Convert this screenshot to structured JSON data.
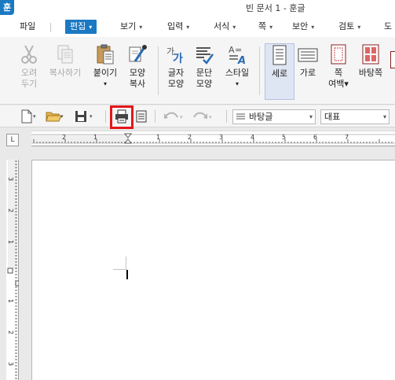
{
  "app": {
    "logo": "훈",
    "title": "빈 문서 1 - 훈글"
  },
  "menu": {
    "items": [
      {
        "label": "파일",
        "arrow": ""
      },
      {
        "label": "편집",
        "arrow": "▾"
      },
      {
        "label": "보기",
        "arrow": "▾"
      },
      {
        "label": "입력",
        "arrow": "▾"
      },
      {
        "label": "서식",
        "arrow": "▾"
      },
      {
        "label": "쪽",
        "arrow": "▾"
      },
      {
        "label": "보안",
        "arrow": "▾"
      },
      {
        "label": "검토",
        "arrow": "▾"
      },
      {
        "label": "도",
        "arrow": ""
      }
    ],
    "active": "편집"
  },
  "ribbon": {
    "cut": "오려\n두기",
    "copy": "복사하기",
    "paste": "붙이기",
    "paste_arrow": "▾",
    "format_copy": "모양\n복사",
    "char_shape": "글자\n모양",
    "para_shape": "문단\n모양",
    "style": "스타일",
    "style_arrow": "▾",
    "portrait": "세로",
    "landscape": "가로",
    "margin": "쪽\n여백▾",
    "background": "바탕쪽"
  },
  "toolbar": {
    "style_value": "바탕글",
    "font_value": "대표",
    "dropdown_arrow": "▾"
  },
  "ruler": {
    "corner": "L",
    "h_labels": [
      "2",
      "1",
      "1",
      "2",
      "3",
      "4",
      "5",
      "6",
      "7"
    ],
    "v_labels": [
      "3",
      "2",
      "1",
      "1",
      "2",
      "3"
    ]
  },
  "colors": {
    "accent": "#1b79c2",
    "highlight": "#e3161b",
    "ribbon_bg": "#f5f5f5",
    "selected_bg": "#dfe6f3"
  }
}
